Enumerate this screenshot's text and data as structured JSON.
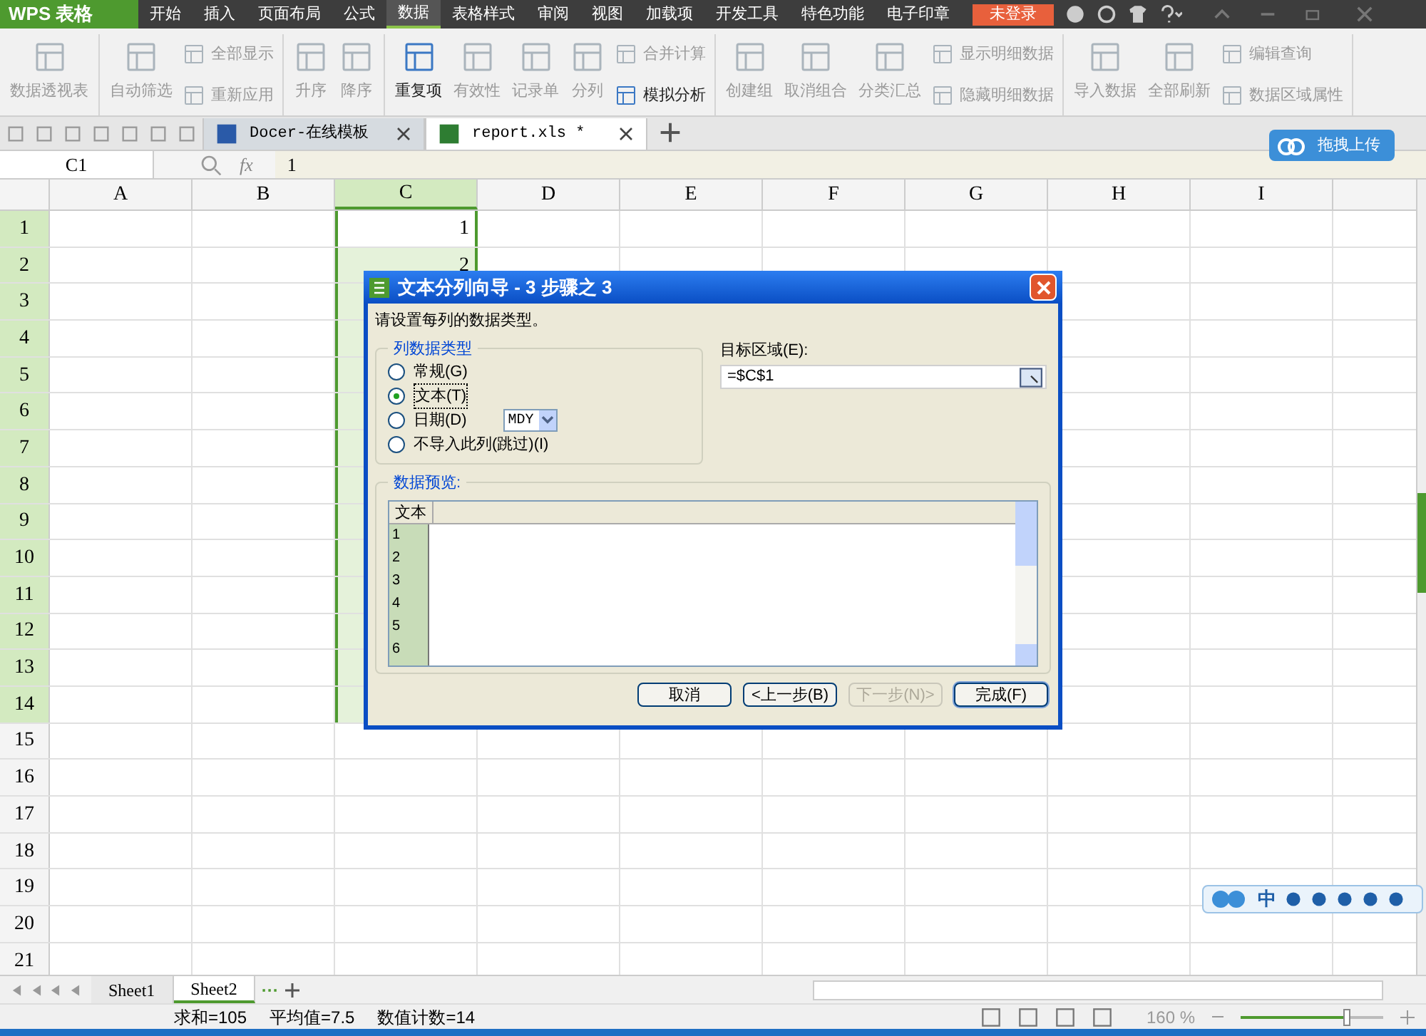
{
  "app": {
    "name": "WPS 表格",
    "login": "未登录"
  },
  "menu_tabs": [
    {
      "label": "开始",
      "selected": false
    },
    {
      "label": "插入",
      "selected": false
    },
    {
      "label": "页面布局",
      "selected": false
    },
    {
      "label": "公式",
      "selected": false
    },
    {
      "label": "数据",
      "selected": true
    },
    {
      "label": "表格样式",
      "selected": false
    },
    {
      "label": "审阅",
      "selected": false
    },
    {
      "label": "视图",
      "selected": false
    },
    {
      "label": "加载项",
      "selected": false
    },
    {
      "label": "开发工具",
      "selected": false
    },
    {
      "label": "特色功能",
      "selected": false
    },
    {
      "label": "电子印章",
      "selected": false
    }
  ],
  "ribbon_groups": [
    {
      "items": [
        {
          "kind": "large",
          "label": "数据透视表",
          "disabled": true
        }
      ]
    },
    {
      "items": [
        {
          "kind": "large",
          "label": "自动筛选",
          "disabled": true
        },
        {
          "kind": "small",
          "label": "全部显示",
          "disabled": true
        },
        {
          "kind": "small",
          "label": "重新应用",
          "disabled": true
        }
      ]
    },
    {
      "items": [
        {
          "kind": "large",
          "label": "升序",
          "disabled": true
        },
        {
          "kind": "large",
          "label": "降序",
          "disabled": true
        }
      ]
    },
    {
      "items": [
        {
          "kind": "large",
          "label": "重复项",
          "disabled": false
        },
        {
          "kind": "large",
          "label": "有效性",
          "disabled": true
        },
        {
          "kind": "large",
          "label": "记录单",
          "disabled": true
        },
        {
          "kind": "large",
          "label": "分列",
          "disabled": true
        },
        {
          "kind": "small",
          "label": "合并计算",
          "disabled": true
        },
        {
          "kind": "small",
          "label": "模拟分析",
          "disabled": false
        }
      ]
    },
    {
      "items": [
        {
          "kind": "large",
          "label": "创建组",
          "disabled": true
        },
        {
          "kind": "large",
          "label": "取消组合",
          "disabled": true
        },
        {
          "kind": "large",
          "label": "分类汇总",
          "disabled": true
        },
        {
          "kind": "small",
          "label": "显示明细数据",
          "disabled": true
        },
        {
          "kind": "small",
          "label": "隐藏明细数据",
          "disabled": true
        }
      ]
    },
    {
      "items": [
        {
          "kind": "large",
          "label": "导入数据",
          "disabled": true
        },
        {
          "kind": "large",
          "label": "全部刷新",
          "disabled": true
        },
        {
          "kind": "small",
          "label": "编辑查询",
          "disabled": true
        },
        {
          "kind": "small",
          "label": "数据区域属性",
          "disabled": true
        }
      ]
    }
  ],
  "doc_tabs": [
    {
      "label": "Docer-在线模板",
      "selected": false
    },
    {
      "label": "report.xls *",
      "selected": true
    }
  ],
  "upload_button": "拖拽上传",
  "formula_bar": {
    "cell_ref": "C1",
    "fx": "fx",
    "value": "1"
  },
  "columns": [
    {
      "label": "A",
      "selected": false
    },
    {
      "label": "B",
      "selected": false
    },
    {
      "label": "C",
      "selected": true
    },
    {
      "label": "D",
      "selected": false
    },
    {
      "label": "E",
      "selected": false
    },
    {
      "label": "F",
      "selected": false
    },
    {
      "label": "G",
      "selected": false
    },
    {
      "label": "H",
      "selected": false
    },
    {
      "label": "I",
      "selected": false
    }
  ],
  "rows": [
    {
      "label": "1",
      "selected": true,
      "c": "1"
    },
    {
      "label": "2",
      "selected": true,
      "c": "2"
    },
    {
      "label": "3",
      "selected": true
    },
    {
      "label": "4",
      "selected": true
    },
    {
      "label": "5",
      "selected": true
    },
    {
      "label": "6",
      "selected": true
    },
    {
      "label": "7",
      "selected": true
    },
    {
      "label": "8",
      "selected": true
    },
    {
      "label": "9",
      "selected": true
    },
    {
      "label": "10",
      "selected": true
    },
    {
      "label": "11",
      "selected": true
    },
    {
      "label": "12",
      "selected": true
    },
    {
      "label": "13",
      "selected": true
    },
    {
      "label": "14",
      "selected": true
    },
    {
      "label": "15",
      "selected": false
    },
    {
      "label": "16",
      "selected": false
    },
    {
      "label": "17",
      "selected": false
    },
    {
      "label": "18",
      "selected": false
    },
    {
      "label": "19",
      "selected": false
    },
    {
      "label": "20",
      "selected": false
    },
    {
      "label": "21",
      "selected": false
    }
  ],
  "sheets": [
    {
      "label": "Sheet1",
      "selected": false
    },
    {
      "label": "Sheet2",
      "selected": true
    }
  ],
  "sheet_more": "···",
  "status": [
    "求和=105",
    "平均值=7.5",
    "数值计数=14"
  ],
  "zoom": {
    "label": "160 %",
    "level": 0.75
  },
  "ime": "中",
  "dialog": {
    "title": "文本分列向导 - 3 步骤之 3",
    "instruction": "请设置每列的数据类型。",
    "group_title": "列数据类型",
    "options": [
      {
        "label": "常规(G)",
        "selected": false
      },
      {
        "label": "文本(T)",
        "selected": true
      },
      {
        "label": "日期(D)",
        "selected": false,
        "format": "MDY"
      },
      {
        "label": "不导入此列(跳过)(I)",
        "selected": false
      }
    ],
    "target_label": "目标区域(E):",
    "target_value": "=$C$1",
    "preview_title": "数据预览:",
    "preview_header": "文本",
    "preview_rows": [
      "1",
      "2",
      "3",
      "4",
      "5",
      "6"
    ],
    "buttons": [
      {
        "label": "取消",
        "disabled": false,
        "default": false
      },
      {
        "label": "<上一步(B)",
        "disabled": false,
        "default": false
      },
      {
        "label": "下一步(N)>",
        "disabled": true,
        "default": false
      },
      {
        "label": "完成(F)",
        "disabled": false,
        "default": true
      }
    ]
  }
}
